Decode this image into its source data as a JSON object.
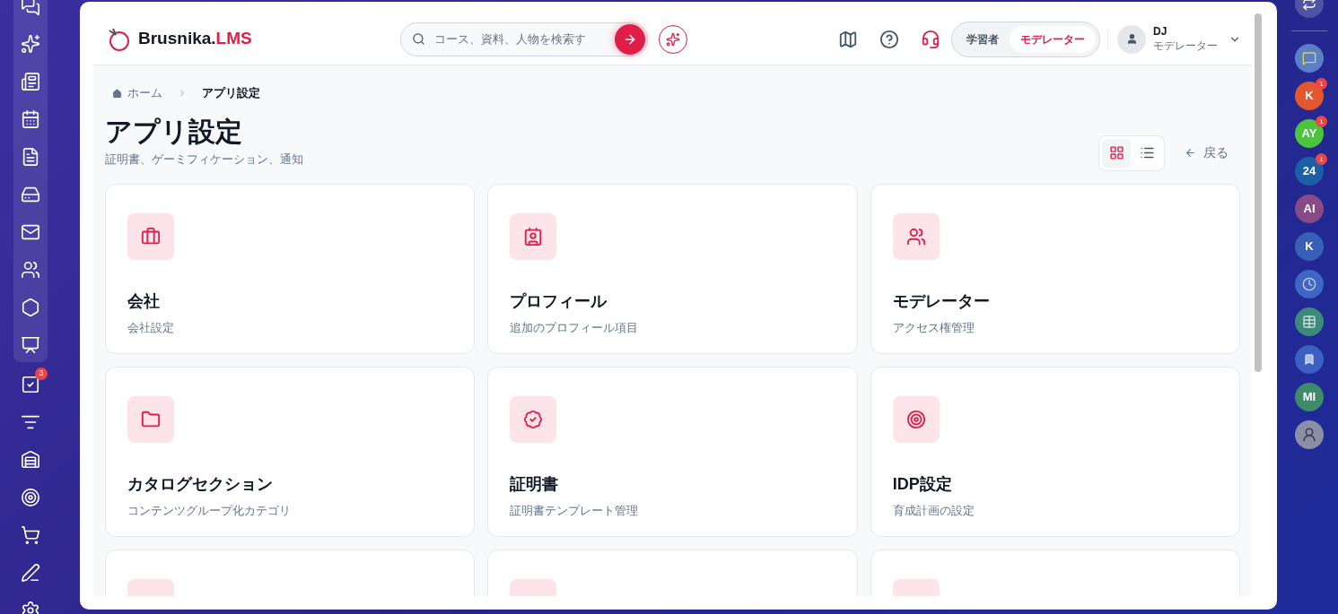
{
  "left_dock": {
    "task_badge": "3"
  },
  "header": {
    "brand": {
      "name": "Brusnika.",
      "accent": "LMS"
    },
    "search": {
      "placeholder": "コース、資料、人物を検索す"
    },
    "roles": [
      {
        "label": "学習者",
        "selected": false
      },
      {
        "label": "モデレーター",
        "selected": true
      }
    ],
    "user": {
      "name": "DJ",
      "role": "モデレーター"
    }
  },
  "breadcrumb": [
    {
      "label": "ホーム"
    },
    {
      "label": "アプリ設定"
    }
  ],
  "page": {
    "title": "アプリ設定",
    "subtitle": "証明書、ゲーミフィケーション、通知",
    "back": "戻る",
    "view_modes": [
      {
        "kind": "grid",
        "selected": true
      },
      {
        "kind": "list",
        "selected": false
      }
    ]
  },
  "cards": [
    {
      "title": "会社",
      "description": "会社設定"
    },
    {
      "title": "プロフィール",
      "description": "追加のプロフィール項目"
    },
    {
      "title": "モデレーター",
      "description": "アクセス権管理"
    },
    {
      "title": "カタログセクション",
      "description": "コンテンツグループ化カテゴリ"
    },
    {
      "title": "証明書",
      "description": "証明書テンプレート管理"
    },
    {
      "title": "IDP設定",
      "description": "育成計画の設定"
    }
  ],
  "right_dock": [
    {
      "kind": "swap"
    },
    {
      "kind": "chat",
      "color": "#5a7fc4"
    },
    {
      "kind": "avatar",
      "initials": "K",
      "color": "#e4572e",
      "badge": "1"
    },
    {
      "kind": "avatar",
      "initials": "AY",
      "color": "#4cc43c",
      "badge": "1"
    },
    {
      "kind": "avatar",
      "initials": "24",
      "color": "#1a5fa8",
      "badge": "1"
    },
    {
      "kind": "avatar",
      "initials": "AI",
      "color": "#8a4a86"
    },
    {
      "kind": "avatar",
      "initials": "K",
      "color": "#3a5fb8"
    },
    {
      "kind": "clock",
      "color": "#3e66c4"
    },
    {
      "kind": "table",
      "color": "#3c8a7a"
    },
    {
      "kind": "bookmark",
      "color": "#3c5fc0"
    },
    {
      "kind": "avatar",
      "initials": "MI",
      "color": "#3f8a6a"
    },
    {
      "kind": "person"
    }
  ]
}
